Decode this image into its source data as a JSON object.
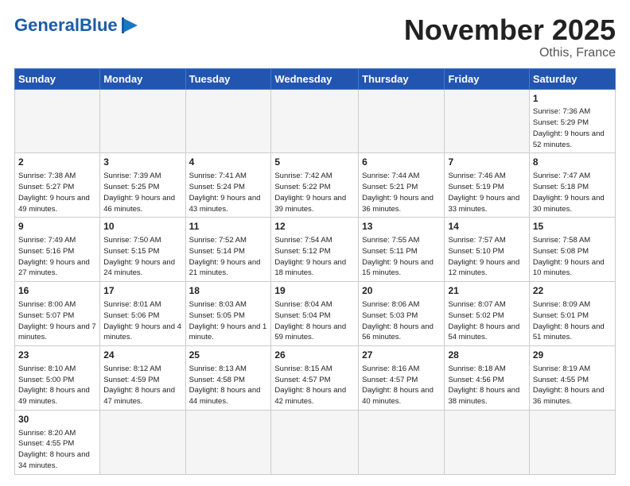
{
  "header": {
    "logo_general": "General",
    "logo_blue": "Blue",
    "month_title": "November 2025",
    "location": "Othis, France"
  },
  "days_of_week": [
    "Sunday",
    "Monday",
    "Tuesday",
    "Wednesday",
    "Thursday",
    "Friday",
    "Saturday"
  ],
  "weeks": [
    [
      {
        "day": "",
        "empty": true
      },
      {
        "day": "",
        "empty": true
      },
      {
        "day": "",
        "empty": true
      },
      {
        "day": "",
        "empty": true
      },
      {
        "day": "",
        "empty": true
      },
      {
        "day": "",
        "empty": true
      },
      {
        "day": "1",
        "sunrise": "7:36 AM",
        "sunset": "5:29 PM",
        "daylight": "9 hours and 52 minutes."
      }
    ],
    [
      {
        "day": "2",
        "sunrise": "7:38 AM",
        "sunset": "5:27 PM",
        "daylight": "9 hours and 49 minutes."
      },
      {
        "day": "3",
        "sunrise": "7:39 AM",
        "sunset": "5:25 PM",
        "daylight": "9 hours and 46 minutes."
      },
      {
        "day": "4",
        "sunrise": "7:41 AM",
        "sunset": "5:24 PM",
        "daylight": "9 hours and 43 minutes."
      },
      {
        "day": "5",
        "sunrise": "7:42 AM",
        "sunset": "5:22 PM",
        "daylight": "9 hours and 39 minutes."
      },
      {
        "day": "6",
        "sunrise": "7:44 AM",
        "sunset": "5:21 PM",
        "daylight": "9 hours and 36 minutes."
      },
      {
        "day": "7",
        "sunrise": "7:46 AM",
        "sunset": "5:19 PM",
        "daylight": "9 hours and 33 minutes."
      },
      {
        "day": "8",
        "sunrise": "7:47 AM",
        "sunset": "5:18 PM",
        "daylight": "9 hours and 30 minutes."
      }
    ],
    [
      {
        "day": "9",
        "sunrise": "7:49 AM",
        "sunset": "5:16 PM",
        "daylight": "9 hours and 27 minutes."
      },
      {
        "day": "10",
        "sunrise": "7:50 AM",
        "sunset": "5:15 PM",
        "daylight": "9 hours and 24 minutes."
      },
      {
        "day": "11",
        "sunrise": "7:52 AM",
        "sunset": "5:14 PM",
        "daylight": "9 hours and 21 minutes."
      },
      {
        "day": "12",
        "sunrise": "7:54 AM",
        "sunset": "5:12 PM",
        "daylight": "9 hours and 18 minutes."
      },
      {
        "day": "13",
        "sunrise": "7:55 AM",
        "sunset": "5:11 PM",
        "daylight": "9 hours and 15 minutes."
      },
      {
        "day": "14",
        "sunrise": "7:57 AM",
        "sunset": "5:10 PM",
        "daylight": "9 hours and 12 minutes."
      },
      {
        "day": "15",
        "sunrise": "7:58 AM",
        "sunset": "5:08 PM",
        "daylight": "9 hours and 10 minutes."
      }
    ],
    [
      {
        "day": "16",
        "sunrise": "8:00 AM",
        "sunset": "5:07 PM",
        "daylight": "9 hours and 7 minutes."
      },
      {
        "day": "17",
        "sunrise": "8:01 AM",
        "sunset": "5:06 PM",
        "daylight": "9 hours and 4 minutes."
      },
      {
        "day": "18",
        "sunrise": "8:03 AM",
        "sunset": "5:05 PM",
        "daylight": "9 hours and 1 minute."
      },
      {
        "day": "19",
        "sunrise": "8:04 AM",
        "sunset": "5:04 PM",
        "daylight": "8 hours and 59 minutes."
      },
      {
        "day": "20",
        "sunrise": "8:06 AM",
        "sunset": "5:03 PM",
        "daylight": "8 hours and 56 minutes."
      },
      {
        "day": "21",
        "sunrise": "8:07 AM",
        "sunset": "5:02 PM",
        "daylight": "8 hours and 54 minutes."
      },
      {
        "day": "22",
        "sunrise": "8:09 AM",
        "sunset": "5:01 PM",
        "daylight": "8 hours and 51 minutes."
      }
    ],
    [
      {
        "day": "23",
        "sunrise": "8:10 AM",
        "sunset": "5:00 PM",
        "daylight": "8 hours and 49 minutes."
      },
      {
        "day": "24",
        "sunrise": "8:12 AM",
        "sunset": "4:59 PM",
        "daylight": "8 hours and 47 minutes."
      },
      {
        "day": "25",
        "sunrise": "8:13 AM",
        "sunset": "4:58 PM",
        "daylight": "8 hours and 44 minutes."
      },
      {
        "day": "26",
        "sunrise": "8:15 AM",
        "sunset": "4:57 PM",
        "daylight": "8 hours and 42 minutes."
      },
      {
        "day": "27",
        "sunrise": "8:16 AM",
        "sunset": "4:57 PM",
        "daylight": "8 hours and 40 minutes."
      },
      {
        "day": "28",
        "sunrise": "8:18 AM",
        "sunset": "4:56 PM",
        "daylight": "8 hours and 38 minutes."
      },
      {
        "day": "29",
        "sunrise": "8:19 AM",
        "sunset": "4:55 PM",
        "daylight": "8 hours and 36 minutes."
      }
    ],
    [
      {
        "day": "30",
        "sunrise": "8:20 AM",
        "sunset": "4:55 PM",
        "daylight": "8 hours and 34 minutes."
      },
      {
        "day": "",
        "empty": true
      },
      {
        "day": "",
        "empty": true
      },
      {
        "day": "",
        "empty": true
      },
      {
        "day": "",
        "empty": true
      },
      {
        "day": "",
        "empty": true
      },
      {
        "day": "",
        "empty": true
      }
    ]
  ]
}
